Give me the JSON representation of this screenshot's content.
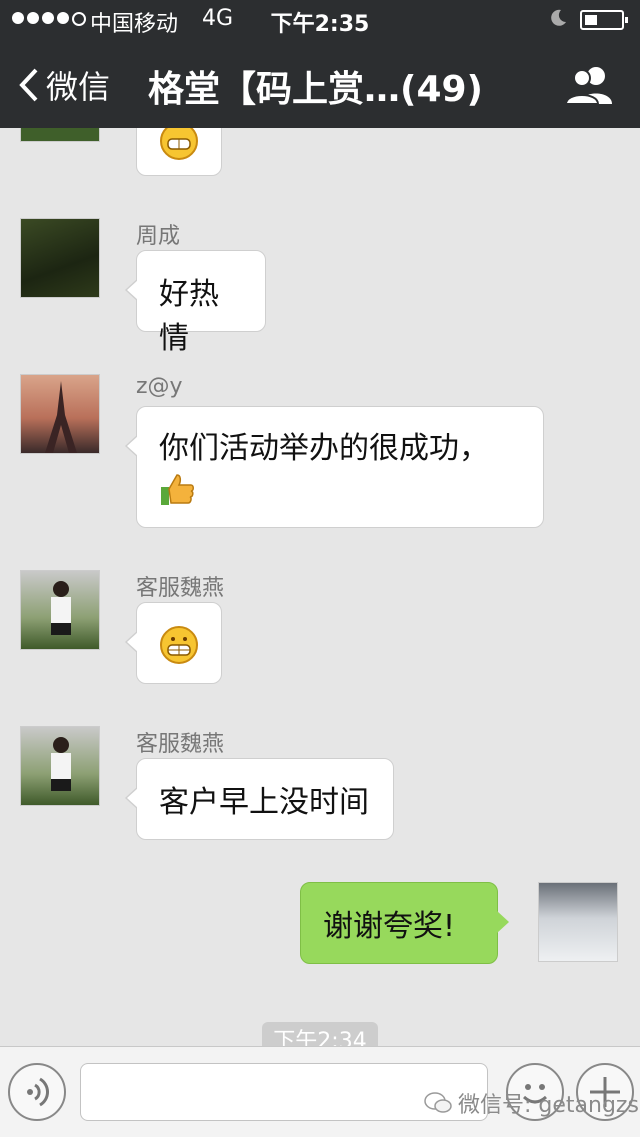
{
  "status": {
    "carrier": "中国移动",
    "network": "4G",
    "time": "下午2:35"
  },
  "nav": {
    "back_label": "微信",
    "title": "格堂【码上赏…(49)"
  },
  "messages": [
    {
      "name": "周成",
      "text": "好热情"
    },
    {
      "name": "z@y",
      "line1": "你们活动举办的很成功，"
    },
    {
      "name": "客服魏燕",
      "icon": "grin-emoji-icon"
    },
    {
      "name": "客服魏燕",
      "text": "客户早上没时间"
    },
    {
      "text": "谢谢夸奖!"
    }
  ],
  "time_chip": "下午2:34",
  "watermark": "微信号: getangzs",
  "colors": {
    "navbar": "#2c2e30",
    "background": "#e6e6e6",
    "sent_bubble": "#97d95c"
  }
}
